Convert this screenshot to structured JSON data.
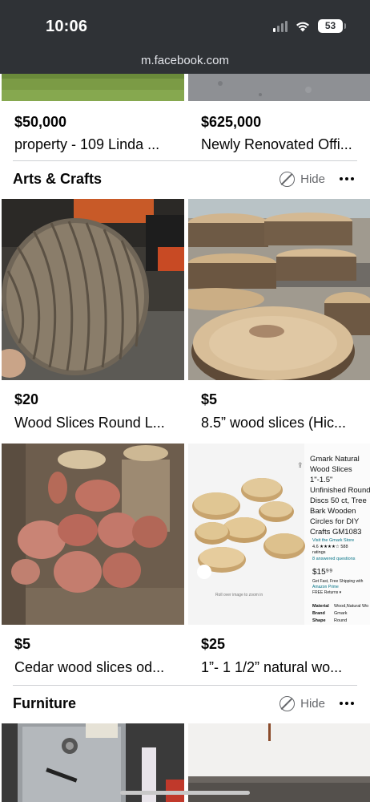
{
  "status_bar": {
    "time": "10:06",
    "battery": "53"
  },
  "browser": {
    "url": "m.facebook.com"
  },
  "top_listings": [
    {
      "price": "$50,000",
      "title": "property - 109 Linda ..."
    },
    {
      "price": "$625,000",
      "title": "Newly Renovated Offi..."
    }
  ],
  "sections": [
    {
      "title": "Arts & Crafts",
      "hide_label": "Hide",
      "listings": [
        {
          "price": "$20",
          "title": "Wood Slices Round L..."
        },
        {
          "price": "$5",
          "title": "8.5” wood slices (Hic..."
        },
        {
          "price": "$5",
          "title": "Cedar wood slices od..."
        },
        {
          "price": "$25",
          "title": "1”- 1 1/2” natural wo..."
        }
      ]
    },
    {
      "title": "Furniture",
      "hide_label": "Hide",
      "listings": []
    }
  ],
  "amazon_ad": {
    "product": "Gmark Natural Wood Slices 1\"-1.5\" Unfinished Round Discs 50 ct, Tree Bark Wooden Circles for DIY Crafts GM1083",
    "store": "Visit the Gmark Store",
    "rating": "4.6",
    "ratings_count": "588",
    "ratings_label": "ratings",
    "answered": "8 answered questions",
    "price": "$15⁹⁹",
    "shipping": "Get Fast, Free Shipping with Amazon Prime",
    "returns": "FREE Returns",
    "material_label": "Material",
    "material": "Wood,Natural Wo",
    "brand_label": "Brand",
    "brand": "Gmark",
    "shape_label": "Shape",
    "shape": "Round",
    "zoom": "Roll over image to zoom in"
  },
  "colors": {
    "status_bar_bg": "#2f3236",
    "text": "#050505",
    "secondary": "#65676b",
    "divider": "#ced0d4"
  }
}
